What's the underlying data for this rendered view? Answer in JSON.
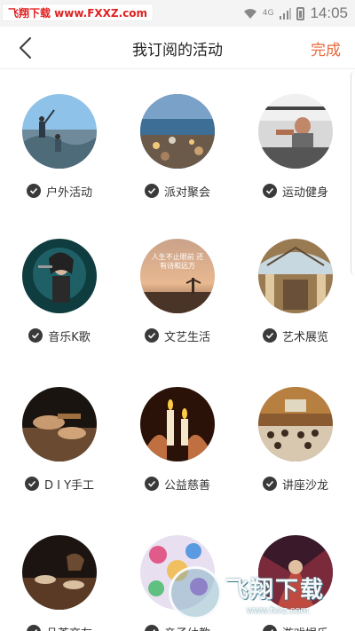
{
  "status_bar": {
    "watermark_badge": "飞翔下载 www.FXXZ.com",
    "time": "14:05",
    "network_label": "4G"
  },
  "header": {
    "title": "我订阅的活动",
    "done_label": "完成"
  },
  "activities": [
    {
      "label": "户外活动",
      "checked": true,
      "icon": "outdoor-photo"
    },
    {
      "label": "派对聚会",
      "checked": true,
      "icon": "party-photo"
    },
    {
      "label": "运动健身",
      "checked": true,
      "icon": "fitness-photo"
    },
    {
      "label": "音乐K歌",
      "checked": true,
      "icon": "music-photo"
    },
    {
      "label": "文艺生活",
      "checked": true,
      "icon": "arts-life-photo",
      "overlay_text": "人生不止眼前 还有诗和远方"
    },
    {
      "label": "艺术展览",
      "checked": true,
      "icon": "exhibition-photo"
    },
    {
      "label": "D I Y手工",
      "checked": true,
      "icon": "diy-photo"
    },
    {
      "label": "公益慈善",
      "checked": true,
      "icon": "charity-photo"
    },
    {
      "label": "讲座沙龙",
      "checked": true,
      "icon": "lecture-photo"
    },
    {
      "label": "品茶交友",
      "checked": true,
      "icon": "tea-photo"
    },
    {
      "label": "亲子幼教",
      "checked": true,
      "icon": "kids-photo"
    },
    {
      "label": "游戏娱乐",
      "checked": true,
      "icon": "game-photo"
    }
  ],
  "watermark": {
    "text": "飞翔下载",
    "url": "www.fxxz.com"
  },
  "colors": {
    "accent": "#e8683a",
    "check_bg": "#3a3a3a"
  }
}
